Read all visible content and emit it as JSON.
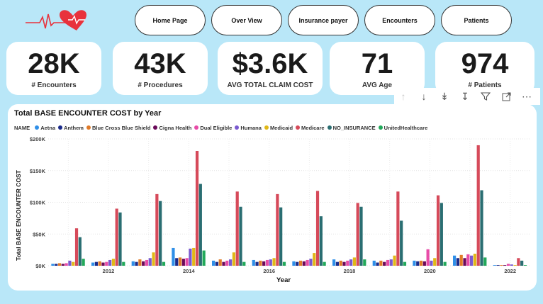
{
  "nav": {
    "home": "Home Page",
    "overview": "Over View",
    "insurance": "Insurance payer",
    "encounters": "Encounters",
    "patients": "Patients"
  },
  "kpis": [
    {
      "value": "28K",
      "label": "# Encounters"
    },
    {
      "value": "43K",
      "label": "# Procedures"
    },
    {
      "value": "$3.6K",
      "label": "AVG TOTAL CLAIM COST"
    },
    {
      "value": "71",
      "label": "AVG Age"
    },
    {
      "value": "974",
      "label": "# Patients"
    }
  ],
  "toolbar_icons": [
    "arrow-up-icon",
    "arrow-down-icon",
    "double-arrow-down-icon",
    "expand-hierarchy-icon",
    "filter-icon",
    "focus-mode-icon",
    "more-options-icon"
  ],
  "colors": {
    "background": "#b9e7f8",
    "heart": "#e8323c"
  },
  "chart_data": {
    "type": "bar",
    "title": "Total BASE ENCOUNTER COST by Year",
    "legend_title": "NAME",
    "xlabel": "Year",
    "ylabel": "Total BASE ENCOUNTER COST",
    "ylim": [
      0,
      200000
    ],
    "y_ticks": [
      0,
      50000,
      100000,
      150000,
      200000
    ],
    "y_tick_labels": [
      "$0K",
      "$50K",
      "$100K",
      "$150K",
      "$200K"
    ],
    "categories": [
      "2011",
      "2012",
      "2013",
      "2014",
      "2015",
      "2016",
      "2017",
      "2018",
      "2019",
      "2020",
      "2021",
      "2022"
    ],
    "x_tick_labels": [
      "",
      "2012",
      "",
      "2014",
      "",
      "2016",
      "",
      "2018",
      "",
      "2020",
      "",
      "2022"
    ],
    "grid": true,
    "legend_position": "top-left",
    "series": [
      {
        "name": "Aetna",
        "color": "#2f8fe8",
        "values": [
          3000,
          5000,
          7000,
          28000,
          8000,
          9000,
          7000,
          10000,
          8000,
          8000,
          16000,
          1000
        ]
      },
      {
        "name": "Anthem",
        "color": "#1a2a8a",
        "values": [
          3000,
          6000,
          6000,
          12000,
          6000,
          6000,
          6000,
          6000,
          5000,
          7000,
          12000,
          1000
        ]
      },
      {
        "name": "Blue Cross Blue Shield",
        "color": "#e07a28",
        "values": [
          4000,
          7000,
          10000,
          13000,
          10000,
          8000,
          8000,
          8000,
          8000,
          8000,
          17000,
          1000
        ]
      },
      {
        "name": "Cigna Health",
        "color": "#6a0a5a",
        "values": [
          3000,
          5000,
          7000,
          11000,
          6000,
          7000,
          7000,
          6000,
          6000,
          7000,
          12000,
          1000
        ]
      },
      {
        "name": "Dual Eligible",
        "color": "#e84ca8",
        "values": [
          4000,
          6000,
          9000,
          12000,
          8000,
          9000,
          9000,
          8000,
          9000,
          26000,
          18000,
          3000
        ]
      },
      {
        "name": "Humana",
        "color": "#7a5ad0",
        "values": [
          8000,
          9000,
          12000,
          27000,
          10000,
          10000,
          11000,
          10000,
          10000,
          8000,
          16000,
          2000
        ]
      },
      {
        "name": "Medicaid",
        "color": "#e0b818",
        "values": [
          6000,
          11000,
          21000,
          28000,
          21000,
          12000,
          20000,
          13000,
          16000,
          12000,
          19000,
          1000
        ]
      },
      {
        "name": "Medicare",
        "color": "#d64a5a",
        "values": [
          59000,
          90000,
          113000,
          181000,
          117000,
          113000,
          118000,
          99000,
          117000,
          111000,
          190000,
          12000
        ]
      },
      {
        "name": "NO_INSURANCE",
        "color": "#2a6e72",
        "values": [
          45000,
          84000,
          102000,
          129000,
          93000,
          92000,
          78000,
          93000,
          71000,
          99000,
          119000,
          8000
        ]
      },
      {
        "name": "UnitedHealthcare",
        "color": "#22a85a",
        "values": [
          11000,
          6000,
          6000,
          24000,
          6000,
          6000,
          6000,
          10000,
          6000,
          6000,
          13000,
          1000
        ]
      }
    ]
  }
}
